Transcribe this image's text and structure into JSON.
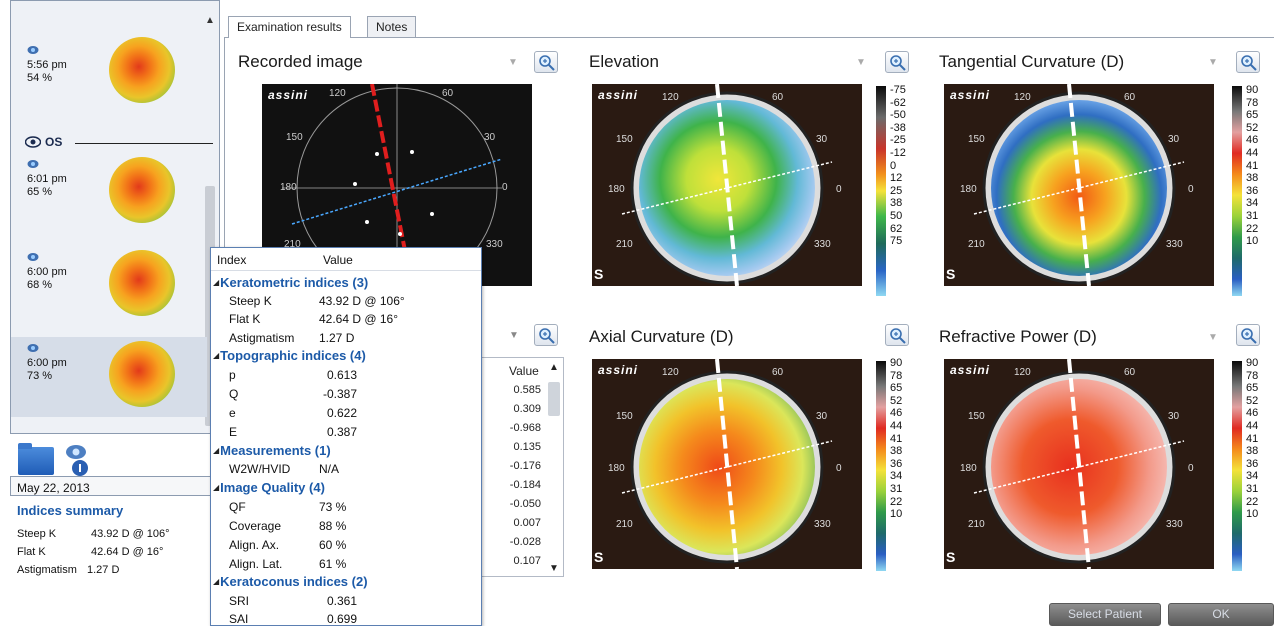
{
  "scan_list": {
    "items": [
      {
        "time": "5:56 pm",
        "pct": "54 %"
      },
      {
        "time": "6:01 pm",
        "pct": "65 %"
      },
      {
        "time": "6:00 pm",
        "pct": "68 %"
      },
      {
        "time": "6:00 pm",
        "pct": "73 %"
      }
    ],
    "eye_label": "OS",
    "date": "May 22, 2013"
  },
  "summary": {
    "title": "Indices summary",
    "rows": [
      {
        "label": "Steep K",
        "value": "43.92 D @ 106°"
      },
      {
        "label": "Flat K",
        "value": "42.64 D @ 16°"
      },
      {
        "label": "Astigmatism",
        "value": "1.27 D"
      }
    ]
  },
  "tabs": [
    "Examination results",
    "Notes"
  ],
  "panels": {
    "recorded": {
      "title": "Recorded image"
    },
    "elevation": {
      "title": "Elevation",
      "scale": [
        "-75",
        "-62",
        "-50",
        "-38",
        "-25",
        "-12",
        "0",
        "12",
        "25",
        "38",
        "50",
        "62",
        "75"
      ]
    },
    "tangential": {
      "title": "Tangential Curvature (D)",
      "scale": [
        "90",
        "78",
        "65",
        "52",
        "46",
        "44",
        "41",
        "38",
        "36",
        "34",
        "31",
        "22",
        "10"
      ]
    },
    "axial": {
      "title": "Axial Curvature (D)",
      "scale": [
        "90",
        "78",
        "65",
        "52",
        "46",
        "44",
        "41",
        "38",
        "36",
        "34",
        "31",
        "22",
        "10"
      ]
    },
    "refractive": {
      "title": "Refractive Power (D)",
      "scale": [
        "90",
        "78",
        "65",
        "52",
        "46",
        "44",
        "41",
        "38",
        "36",
        "34",
        "31",
        "22",
        "10"
      ]
    }
  },
  "map_common": {
    "brand": "assini",
    "os_tag": "S",
    "angles": {
      "a120": "120",
      "a60": "60",
      "a150": "150",
      "a30": "30",
      "a180": "180",
      "a0": "0",
      "a210": "210",
      "a330": "330"
    }
  },
  "mid_list": {
    "header": "Value",
    "values": [
      "0.585",
      "0.309",
      "-0.968",
      "0.135",
      "-0.176",
      "-0.184",
      "-0.050",
      "0.007",
      "-0.028",
      "0.107"
    ]
  },
  "popup": {
    "col_index": "Index",
    "col_value": "Value",
    "groups": [
      {
        "title": "Keratometric indices (3)",
        "rows": [
          {
            "k": "Steep K",
            "v": "43.92 D @ 106°"
          },
          {
            "k": "Flat K",
            "v": "42.64 D @ 16°"
          },
          {
            "k": "Astigmatism",
            "v": "1.27 D"
          }
        ]
      },
      {
        "title": "Topographic indices (4)",
        "rows": [
          {
            "k": "p",
            "v": "0.613"
          },
          {
            "k": "Q",
            "v": "-0.387"
          },
          {
            "k": "e",
            "v": "0.622"
          },
          {
            "k": "E",
            "v": "0.387"
          }
        ]
      },
      {
        "title": "Measurements (1)",
        "rows": [
          {
            "k": "W2W/HVID",
            "v": "N/A"
          }
        ]
      },
      {
        "title": "Image Quality (4)",
        "rows": [
          {
            "k": "QF",
            "v": "73 %"
          },
          {
            "k": "Coverage",
            "v": "88 %"
          },
          {
            "k": "Align. Ax.",
            "v": "60 %"
          },
          {
            "k": "Align. Lat.",
            "v": "61 %"
          }
        ]
      },
      {
        "title": "Keratoconus indices (2)",
        "rows": [
          {
            "k": "SRI",
            "v": "0.361"
          },
          {
            "k": "SAI",
            "v": "0.699"
          }
        ]
      }
    ]
  },
  "buttons": {
    "select_patient": "Select Patient",
    "ok": "OK"
  }
}
